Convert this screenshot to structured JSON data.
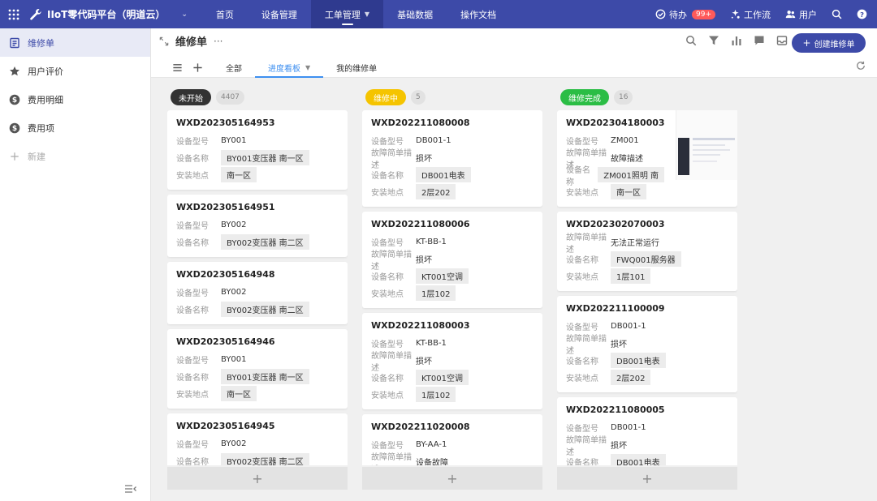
{
  "app": {
    "title": "IIoT零代码平台（明道云）",
    "nav_tabs": [
      {
        "label": "首页"
      },
      {
        "label": "设备管理"
      },
      {
        "label": "工单管理"
      },
      {
        "label": "基础数据"
      },
      {
        "label": "操作文档"
      }
    ],
    "right": {
      "todo_label": "待办",
      "todo_badge": "99+",
      "workflow_label": "工作流",
      "users_label": "用户"
    }
  },
  "sidebar": {
    "items": [
      {
        "label": "维修单"
      },
      {
        "label": "用户评价"
      },
      {
        "label": "费用明细"
      },
      {
        "label": "费用项"
      }
    ],
    "add_label": "新建"
  },
  "header": {
    "title": "维修单",
    "more": "···",
    "create_label": "创建维修单",
    "view_tabs": [
      {
        "label": "全部"
      },
      {
        "label": "进度看板"
      },
      {
        "label": "我的维修单"
      }
    ]
  },
  "colors": {
    "primary": "#3d4aa8",
    "not_started": "#333333",
    "in_progress": "#f5c400",
    "done": "#2bbd45"
  },
  "columns": [
    {
      "status": "未开始",
      "count": "4407",
      "cards": [
        {
          "id": "WXD202305164953",
          "fields": [
            {
              "label": "设备型号",
              "value": "BY001",
              "tag": false
            },
            {
              "label": "设备名称",
              "value": "BY001变压器 南一区",
              "tag": true
            },
            {
              "label": "安装地点",
              "value": "南一区",
              "tag": true
            }
          ]
        },
        {
          "id": "WXD202305164951",
          "fields": [
            {
              "label": "设备型号",
              "value": "BY002",
              "tag": false
            },
            {
              "label": "设备名称",
              "value": "BY002变压器 南二区",
              "tag": true
            }
          ]
        },
        {
          "id": "WXD202305164948",
          "fields": [
            {
              "label": "设备型号",
              "value": "BY002",
              "tag": false
            },
            {
              "label": "设备名称",
              "value": "BY002变压器 南二区",
              "tag": true
            }
          ]
        },
        {
          "id": "WXD202305164946",
          "fields": [
            {
              "label": "设备型号",
              "value": "BY001",
              "tag": false
            },
            {
              "label": "设备名称",
              "value": "BY001变压器 南一区",
              "tag": true
            },
            {
              "label": "安装地点",
              "value": "南一区",
              "tag": true
            }
          ]
        },
        {
          "id": "WXD202305164945",
          "fields": [
            {
              "label": "设备型号",
              "value": "BY002",
              "tag": false
            },
            {
              "label": "设备名称",
              "value": "BY002变压器 南二区",
              "tag": true
            }
          ]
        }
      ]
    },
    {
      "status": "维修中",
      "count": "5",
      "cards": [
        {
          "id": "WXD202211080008",
          "fields": [
            {
              "label": "设备型号",
              "value": "DB001-1",
              "tag": false
            },
            {
              "label": "故障简单描述",
              "value": "损坏",
              "tag": false
            },
            {
              "label": "设备名称",
              "value": "DB001电表",
              "tag": true
            },
            {
              "label": "安装地点",
              "value": "2层202",
              "tag": true
            }
          ]
        },
        {
          "id": "WXD202211080006",
          "fields": [
            {
              "label": "设备型号",
              "value": "KT-BB-1",
              "tag": false
            },
            {
              "label": "故障简单描述",
              "value": "损坏",
              "tag": false
            },
            {
              "label": "设备名称",
              "value": "KT001空调",
              "tag": true
            },
            {
              "label": "安装地点",
              "value": "1层102",
              "tag": true
            }
          ]
        },
        {
          "id": "WXD202211080003",
          "fields": [
            {
              "label": "设备型号",
              "value": "KT-BB-1",
              "tag": false
            },
            {
              "label": "故障简单描述",
              "value": "损坏",
              "tag": false
            },
            {
              "label": "设备名称",
              "value": "KT001空调",
              "tag": true
            },
            {
              "label": "安装地点",
              "value": "1层102",
              "tag": true
            }
          ]
        },
        {
          "id": "WXD202211020008",
          "fields": [
            {
              "label": "设备型号",
              "value": "BY-AA-1",
              "tag": false
            },
            {
              "label": "故障简单描述",
              "value": "设备故障",
              "tag": false
            }
          ]
        }
      ]
    },
    {
      "status": "维修完成",
      "count": "16",
      "cards": [
        {
          "id": "WXD202304180003",
          "thumb": true,
          "fields": [
            {
              "label": "设备型号",
              "value": "ZM001",
              "tag": false
            },
            {
              "label": "故障简单描述",
              "value": "故障描述",
              "tag": false
            },
            {
              "label": "设备名称",
              "value": "ZM001照明 南",
              "tag": true
            },
            {
              "label": "安装地点",
              "value": "南一区",
              "tag": true
            }
          ]
        },
        {
          "id": "WXD202302070003",
          "fields": [
            {
              "label": "故障简单描述",
              "value": "无法正常运行",
              "tag": false
            },
            {
              "label": "设备名称",
              "value": "FWQ001服务器",
              "tag": true
            },
            {
              "label": "安装地点",
              "value": "1层101",
              "tag": true
            }
          ]
        },
        {
          "id": "WXD202211100009",
          "fields": [
            {
              "label": "设备型号",
              "value": "DB001-1",
              "tag": false
            },
            {
              "label": "故障简单描述",
              "value": "损坏",
              "tag": false
            },
            {
              "label": "设备名称",
              "value": "DB001电表",
              "tag": true
            },
            {
              "label": "安装地点",
              "value": "2层202",
              "tag": true
            }
          ]
        },
        {
          "id": "WXD202211080005",
          "fields": [
            {
              "label": "设备型号",
              "value": "DB001-1",
              "tag": false
            },
            {
              "label": "故障简单描述",
              "value": "损坏",
              "tag": false
            },
            {
              "label": "设备名称",
              "value": "DB001电表",
              "tag": true
            }
          ]
        }
      ]
    }
  ],
  "add_card_symbol": "+"
}
